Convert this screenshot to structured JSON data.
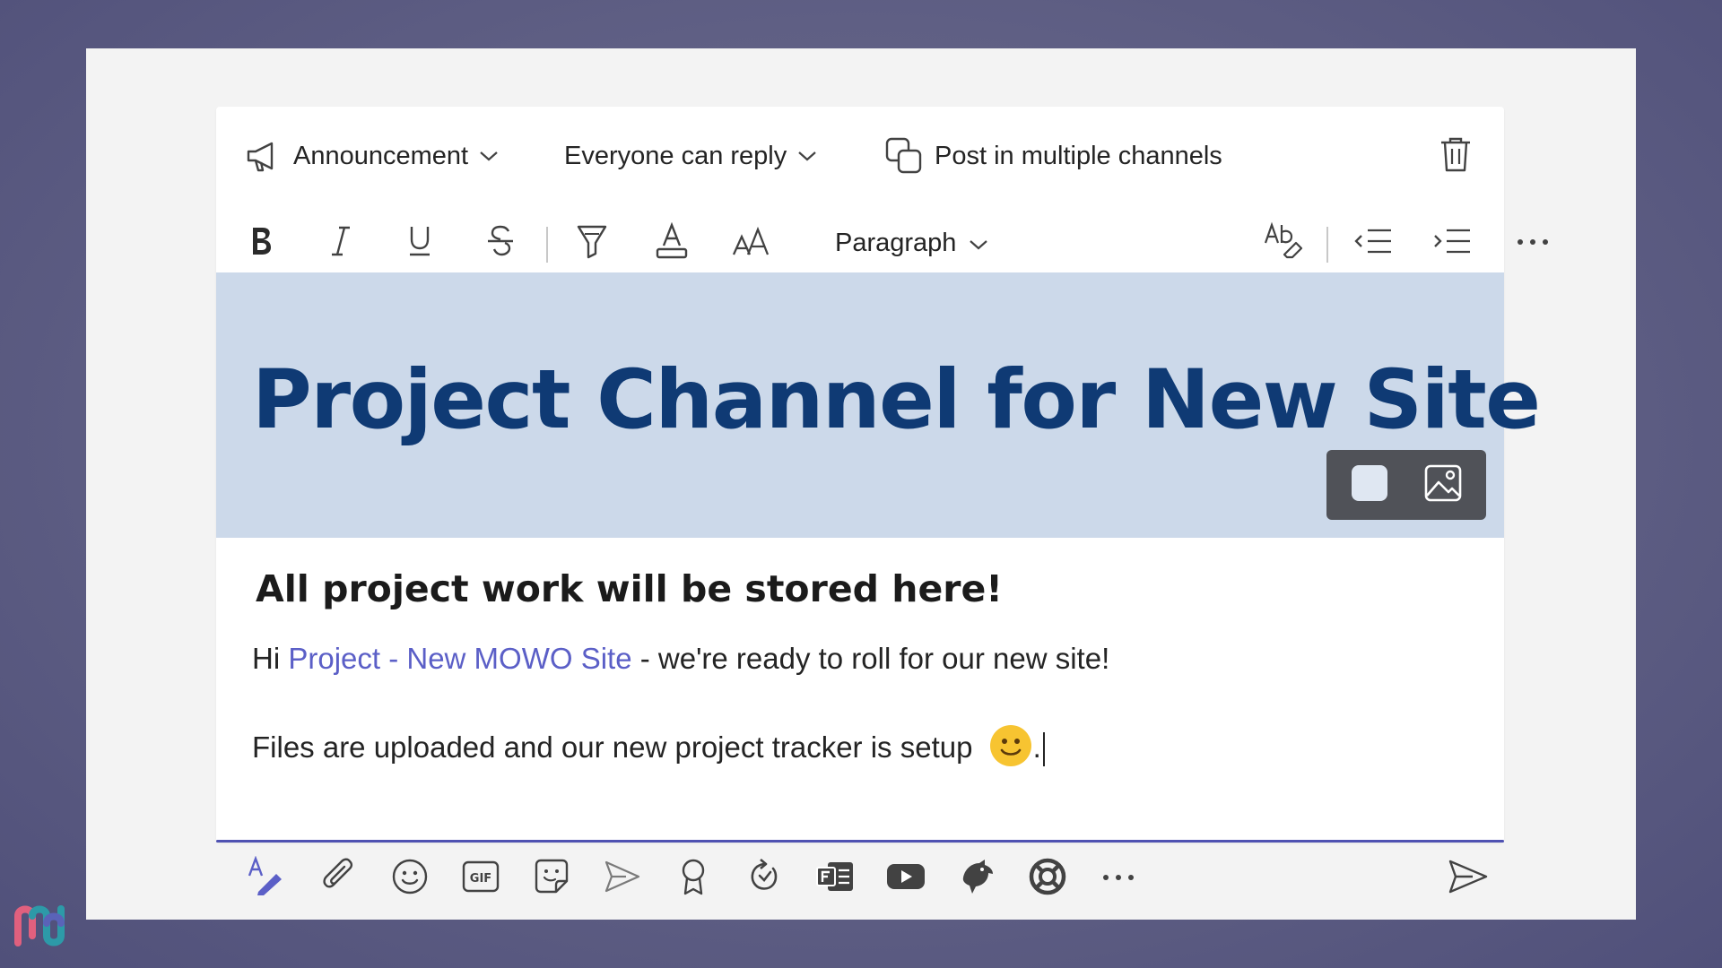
{
  "post_options": {
    "type_label": "Announcement",
    "reply_label": "Everyone can reply",
    "multi_channel_label": "Post in multiple channels"
  },
  "format_toolbar": {
    "paragraph_label": "Paragraph"
  },
  "announcement": {
    "banner_title": "Project Channel for New Site",
    "subhead": "All project work will be stored here!",
    "line1_prefix": "Hi ",
    "line1_mention": "Project - New MOWO Site",
    "line1_suffix": " - we're ready to roll for our new site!",
    "line2_text": "Files are uploaded and our new project tracker is setup",
    "line2_end": "."
  },
  "colors": {
    "banner_bg": "#ccd9ea",
    "banner_title": "#0f3a74",
    "mention": "#5b5fc7",
    "accent_underline": "#4f52b2",
    "emoji": "#f7c431"
  },
  "icons": {
    "bottom_toolbar": [
      "format-icon",
      "attach-icon",
      "emoji-icon",
      "gif-icon",
      "sticker-icon",
      "meet-icon",
      "praise-icon",
      "loop-icon",
      "forms-icon",
      "youtube-icon",
      "bird-icon",
      "help-icon",
      "more-icon"
    ]
  }
}
